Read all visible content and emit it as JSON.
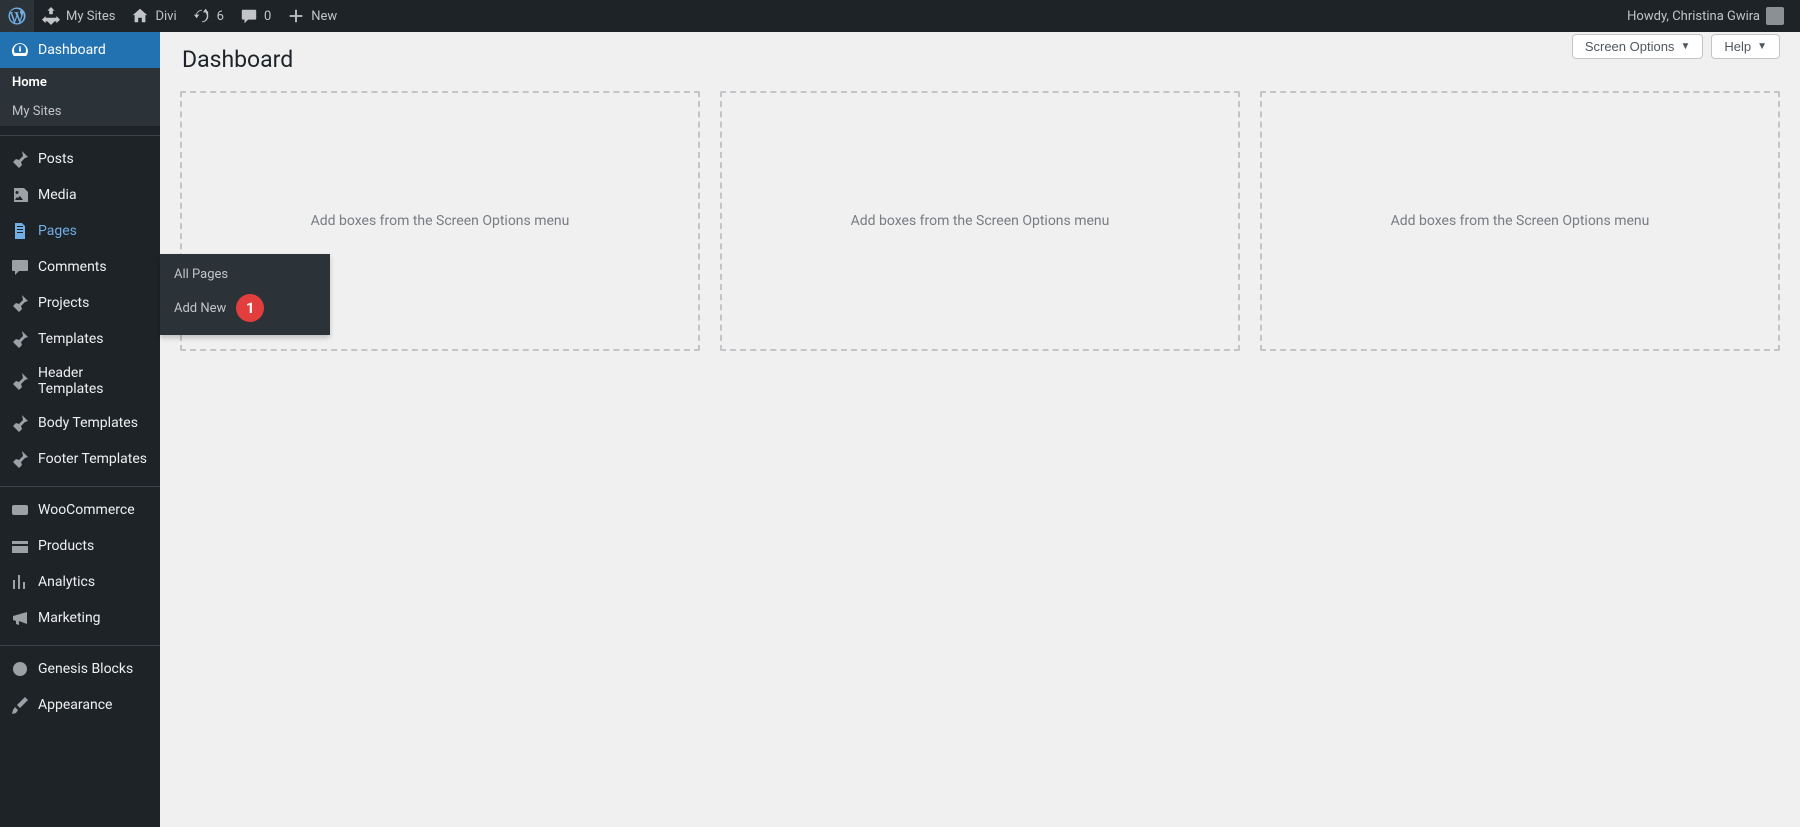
{
  "adminbar": {
    "my_sites": "My Sites",
    "site_name": "Divi",
    "updates_count": "6",
    "comments_count": "0",
    "new_label": "New",
    "greeting": "Howdy, Christina Gwira"
  },
  "sidebar": {
    "dashboard": "Dashboard",
    "submenu": {
      "home": "Home",
      "my_sites": "My Sites"
    },
    "posts": "Posts",
    "media": "Media",
    "pages": "Pages",
    "comments": "Comments",
    "projects": "Projects",
    "templates": "Templates",
    "header_templates": "Header Templates",
    "body_templates": "Body Templates",
    "footer_templates": "Footer Templates",
    "woocommerce": "WooCommerce",
    "products": "Products",
    "analytics": "Analytics",
    "marketing": "Marketing",
    "genesis_blocks": "Genesis Blocks",
    "appearance": "Appearance"
  },
  "flyout": {
    "all_pages": "All Pages",
    "add_new": "Add New",
    "callout": "1"
  },
  "main": {
    "title": "Dashboard",
    "screen_options": "Screen Options",
    "help": "Help",
    "empty_box_hint": "Add boxes from the Screen Options menu"
  }
}
